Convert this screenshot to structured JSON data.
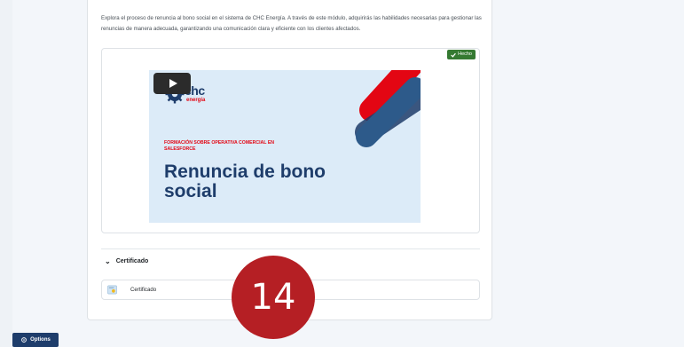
{
  "module": {
    "description": "Explora el proceso de renuncia al bono social en el sistema de CHC Energía. A través de este módulo, adquirirás las habilidades necesarias para gestionar las renuncias de manera adecuada, garantizando una comunicación clara y eficiente con los clientes afectados."
  },
  "activity": {
    "status_label": "Hecho",
    "status_color": "#357a32"
  },
  "video": {
    "logo_text": "chc",
    "logo_sub": "energía",
    "slide_tag": "FORMACIÓN SOBRE OPERATIVA COMERCIAL EN SALESFORCE",
    "slide_title": "Renuncia de bono social"
  },
  "section": {
    "title": "Certificado",
    "items": [
      {
        "label": "Certificado",
        "icon": "certificate-icon"
      }
    ]
  },
  "overlay_badge": "14",
  "footer": {
    "options_label": "Options"
  },
  "colors": {
    "brand_navy": "#1e3d6b",
    "brand_red": "#e30613",
    "badge_red": "#b51f24"
  }
}
